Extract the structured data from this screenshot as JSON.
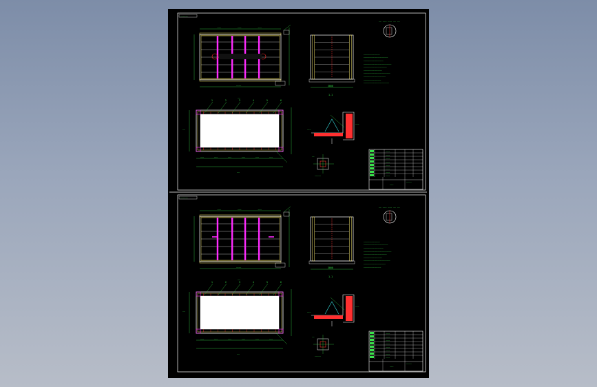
{
  "viewer": {
    "background_top": "#7d8da8",
    "background_bottom": "#b7bdc8"
  },
  "sheet": {
    "background": "#000000",
    "frame_color": "#ffffff"
  },
  "drawings": [
    {
      "id": "upper",
      "section_label": "1-1",
      "dimension_label": "3000",
      "pin_label": "1:10",
      "plan_label": "1:10"
    },
    {
      "id": "lower",
      "section_label": "1-1",
      "dimension_label": "3000",
      "pin_label": "1:10",
      "plan_label": "1:10"
    }
  ],
  "colors": {
    "outline": "#ffffff",
    "dimension": "#39e24b",
    "beam": "#ff2bff",
    "frame": "#f3e36b",
    "hatch": "#ff3030",
    "detail": "#39e2e2"
  }
}
